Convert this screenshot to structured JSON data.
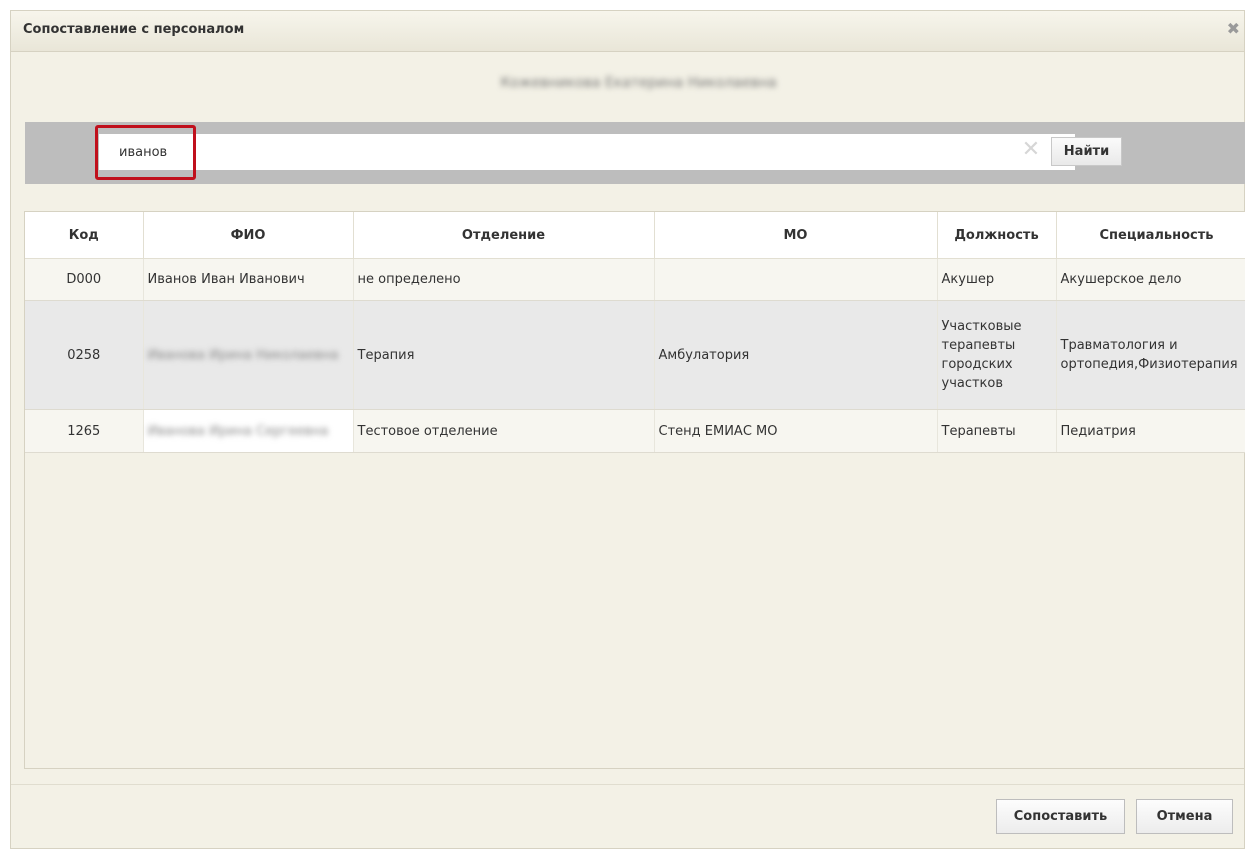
{
  "dialog": {
    "title": "Сопоставление с персоналом",
    "close_icon": "close-icon",
    "person_name": "Кожевникова Екатерина Николаевна"
  },
  "search": {
    "value": "иванов",
    "placeholder": "",
    "button_label": "Найти",
    "clear_icon": "clear-icon"
  },
  "table": {
    "headers": [
      "Код",
      "ФИО",
      "Отделение",
      "МО",
      "Должность",
      "Специальность"
    ],
    "rows": [
      {
        "code": "D000",
        "fio": "Иванов Иван Иванович",
        "department": "не определено",
        "mo": "",
        "position": "Акушер",
        "specialty": "Акушерское дело"
      },
      {
        "code": "0258",
        "fio": "Иванова Ирина Николаевна",
        "department": "Терапия",
        "mo": "Амбулатория",
        "position": "Участковые терапевты городских участков",
        "specialty": "Травматология и ортопедия,Физиотерапия"
      },
      {
        "code": "1265",
        "fio": "Иванова Ирина Сергеевна",
        "department": "Тестовое отделение",
        "mo": "Стенд ЕМИАС МО",
        "position": "Терапевты",
        "specialty": "Педиатрия"
      }
    ]
  },
  "footer": {
    "map_button": "Сопоставить",
    "cancel_button": "Отмена"
  },
  "colors": {
    "dialog_bg": "#f3f1e6",
    "search_bar_bg": "#bdbdbd",
    "highlight_border": "#c0101c",
    "selected_row_bg": "#e9e9e9"
  }
}
